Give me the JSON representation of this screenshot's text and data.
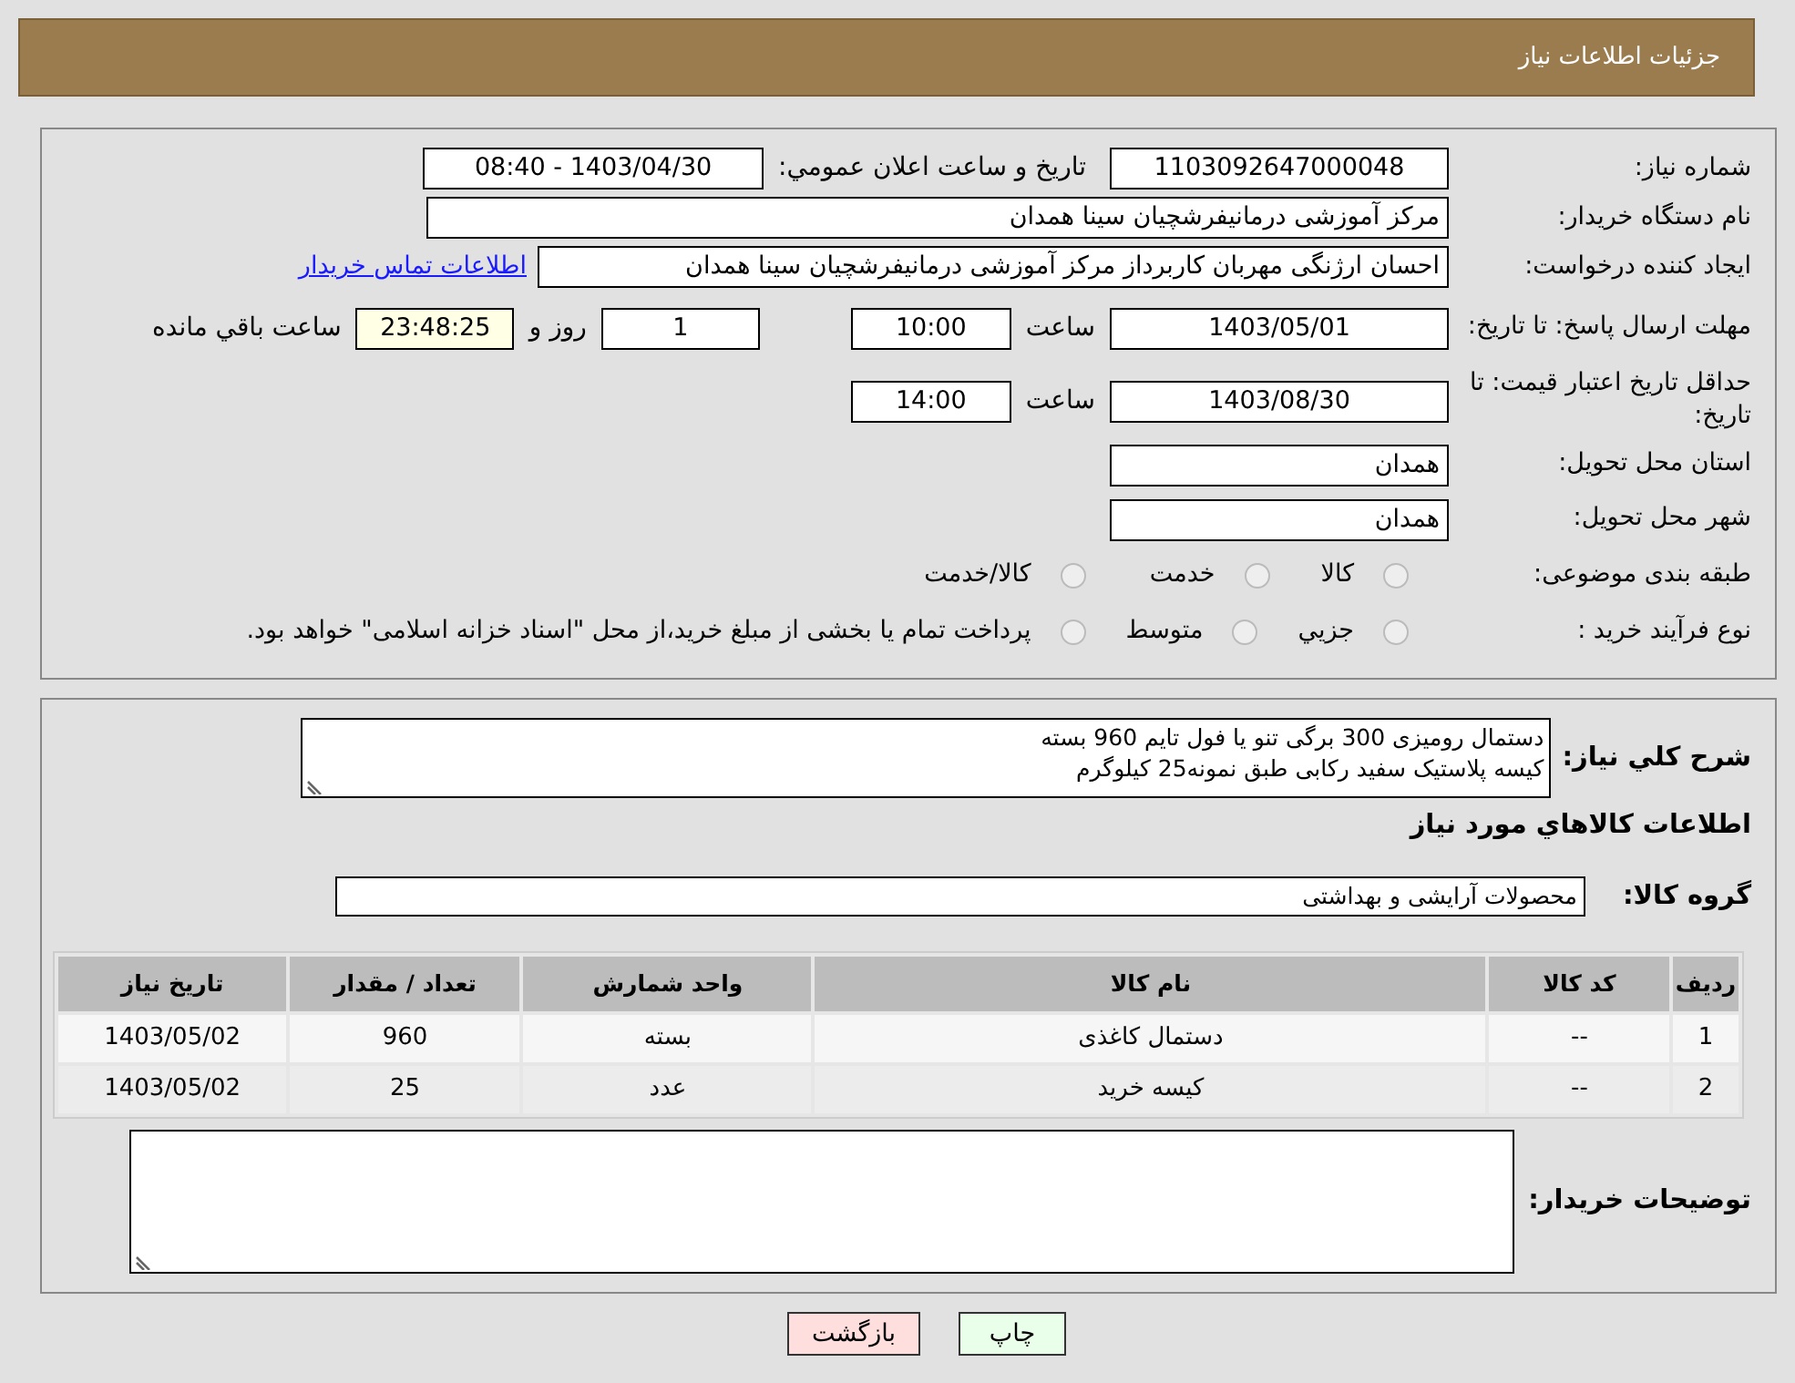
{
  "header": {
    "title": "جزئیات اطلاعات نیاز"
  },
  "need_number": {
    "label": "شماره نیاز:",
    "value": "1103092647000048"
  },
  "announce": {
    "label": "تاریخ و ساعت اعلان عمومي:",
    "value": "1403/04/30 - 08:40"
  },
  "buyer": {
    "label": "نام دستگاه خریدار:",
    "value": "مرکز آموزشی درمانیفرشچیان سینا همدان"
  },
  "creator": {
    "label": "ایجاد کننده درخواست:",
    "value": "احسان ارژنگی مهربان کاربرداز مرکز آموزشی درمانیفرشچیان سینا همدان",
    "link": "اطلاعات تماس خریدار"
  },
  "deadline": {
    "label": "مهلت ارسال پاسخ: تا تاریخ:",
    "date": "1403/05/01",
    "time_label": "ساعت",
    "time": "10:00",
    "days": "1",
    "days_label": "روز و",
    "remaining": "23:48:25",
    "remaining_label": "ساعت باقي مانده"
  },
  "validity": {
    "label": "حداقل تاریخ اعتبار قیمت: تا تاریخ:",
    "date": "1403/08/30",
    "time_label": "ساعت",
    "time": "14:00"
  },
  "province": {
    "label": "استان محل تحویل:",
    "value": "همدان"
  },
  "city": {
    "label": "شهر محل تحویل:",
    "value": "همدان"
  },
  "category": {
    "label": "طبقه بندی موضوعی:",
    "options": [
      {
        "label": "کالا",
        "selected": false
      },
      {
        "label": "خدمت",
        "selected": false
      },
      {
        "label": "کالا/خدمت",
        "selected": false
      }
    ]
  },
  "purchase_type": {
    "label": "نوع فرآیند خرید :",
    "options": [
      {
        "label": "جزيي",
        "selected": false
      },
      {
        "label": "متوسط",
        "selected": false
      },
      {
        "label": "پرداخت تمام یا بخشی از مبلغ خرید،از محل \"اسناد خزانه اسلامی\" خواهد بود.",
        "selected": false
      }
    ]
  },
  "description": {
    "label": "شرح کلي نياز:",
    "lines": [
      "دستمال رومیزی 300 برگی تنو یا فول تایم 960 بسته",
      "کیسه پلاستیک سفید رکابی طبق نمونه25 کیلوگرم"
    ]
  },
  "goods_heading": "اطلاعات کالاهاي مورد نياز",
  "goods_group": {
    "label": "گروه کالا:",
    "value": "محصولات آرایشی و بهداشتی"
  },
  "table": {
    "columns": [
      "ردیف",
      "کد کالا",
      "نام کالا",
      "واحد شمارش",
      "تعداد / مقدار",
      "تاریخ نیاز"
    ],
    "rows": [
      [
        "1",
        "--",
        "دستمال کاغذی",
        "بسته",
        "960",
        "1403/05/02"
      ],
      [
        "2",
        "--",
        "کیسه خرید",
        "عدد",
        "25",
        "1403/05/02"
      ]
    ]
  },
  "buyer_notes": {
    "label": "توضیحات خریدار:"
  },
  "buttons": [
    {
      "label": "چاپ",
      "kind": "print"
    },
    {
      "label": "بازگشت",
      "kind": "back"
    }
  ]
}
